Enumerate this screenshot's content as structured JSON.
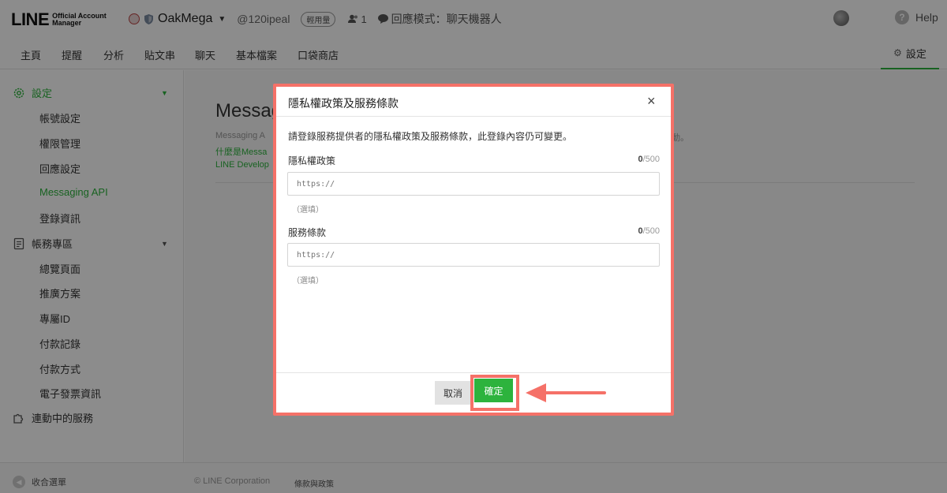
{
  "header": {
    "logo_main": "LINE",
    "logo_sub_1": "Official Account",
    "logo_sub_2": "Manager",
    "account_name": "OakMega",
    "account_id": "@120ipeal",
    "plan_badge": "輕用量",
    "friend_count": "1",
    "response_mode": "回應模式：聊天機器人",
    "help_label": "Help"
  },
  "nav": {
    "items": [
      "主頁",
      "提醒",
      "分析",
      "貼文串",
      "聊天",
      "基本檔案",
      "口袋商店"
    ],
    "settings_label": "設定"
  },
  "sidebar": {
    "settings_label": "設定",
    "settings_items": [
      "帳號設定",
      "權限管理",
      "回應設定",
      "Messaging API",
      "登錄資訊"
    ],
    "billing_label": "帳務專區",
    "billing_items": [
      "總覽頁面",
      "推廣方案",
      "專屬ID",
      "付款記錄",
      "付款方式",
      "電子發票資訊"
    ],
    "services_label": "連動中的服務",
    "collapse_label": "收合選單"
  },
  "main": {
    "title": "Messag",
    "desc": "Messaging A",
    "desc_tail": "動。",
    "link1": "什麼是Messa",
    "link2": "LINE Develop"
  },
  "footer": {
    "copyright": "© LINE Corporation",
    "terms": "條款與政策"
  },
  "modal": {
    "title": "隱私權政策及服務條款",
    "close": "×",
    "intro": "請登錄服務提供者的隱私權政策及服務條款，此登錄內容仍可變更。",
    "privacy_label": "隱私權政策",
    "privacy_count": "0",
    "privacy_max": "/500",
    "privacy_placeholder": "https://",
    "privacy_hint": "（選填）",
    "terms_label": "服務條款",
    "terms_count": "0",
    "terms_max": "/500",
    "terms_placeholder": "https://",
    "terms_hint": "（選填）",
    "cancel_label": "取消",
    "ok_label": "確定"
  },
  "colors": {
    "accent": "#2db33d",
    "highlight": "#f57168"
  }
}
